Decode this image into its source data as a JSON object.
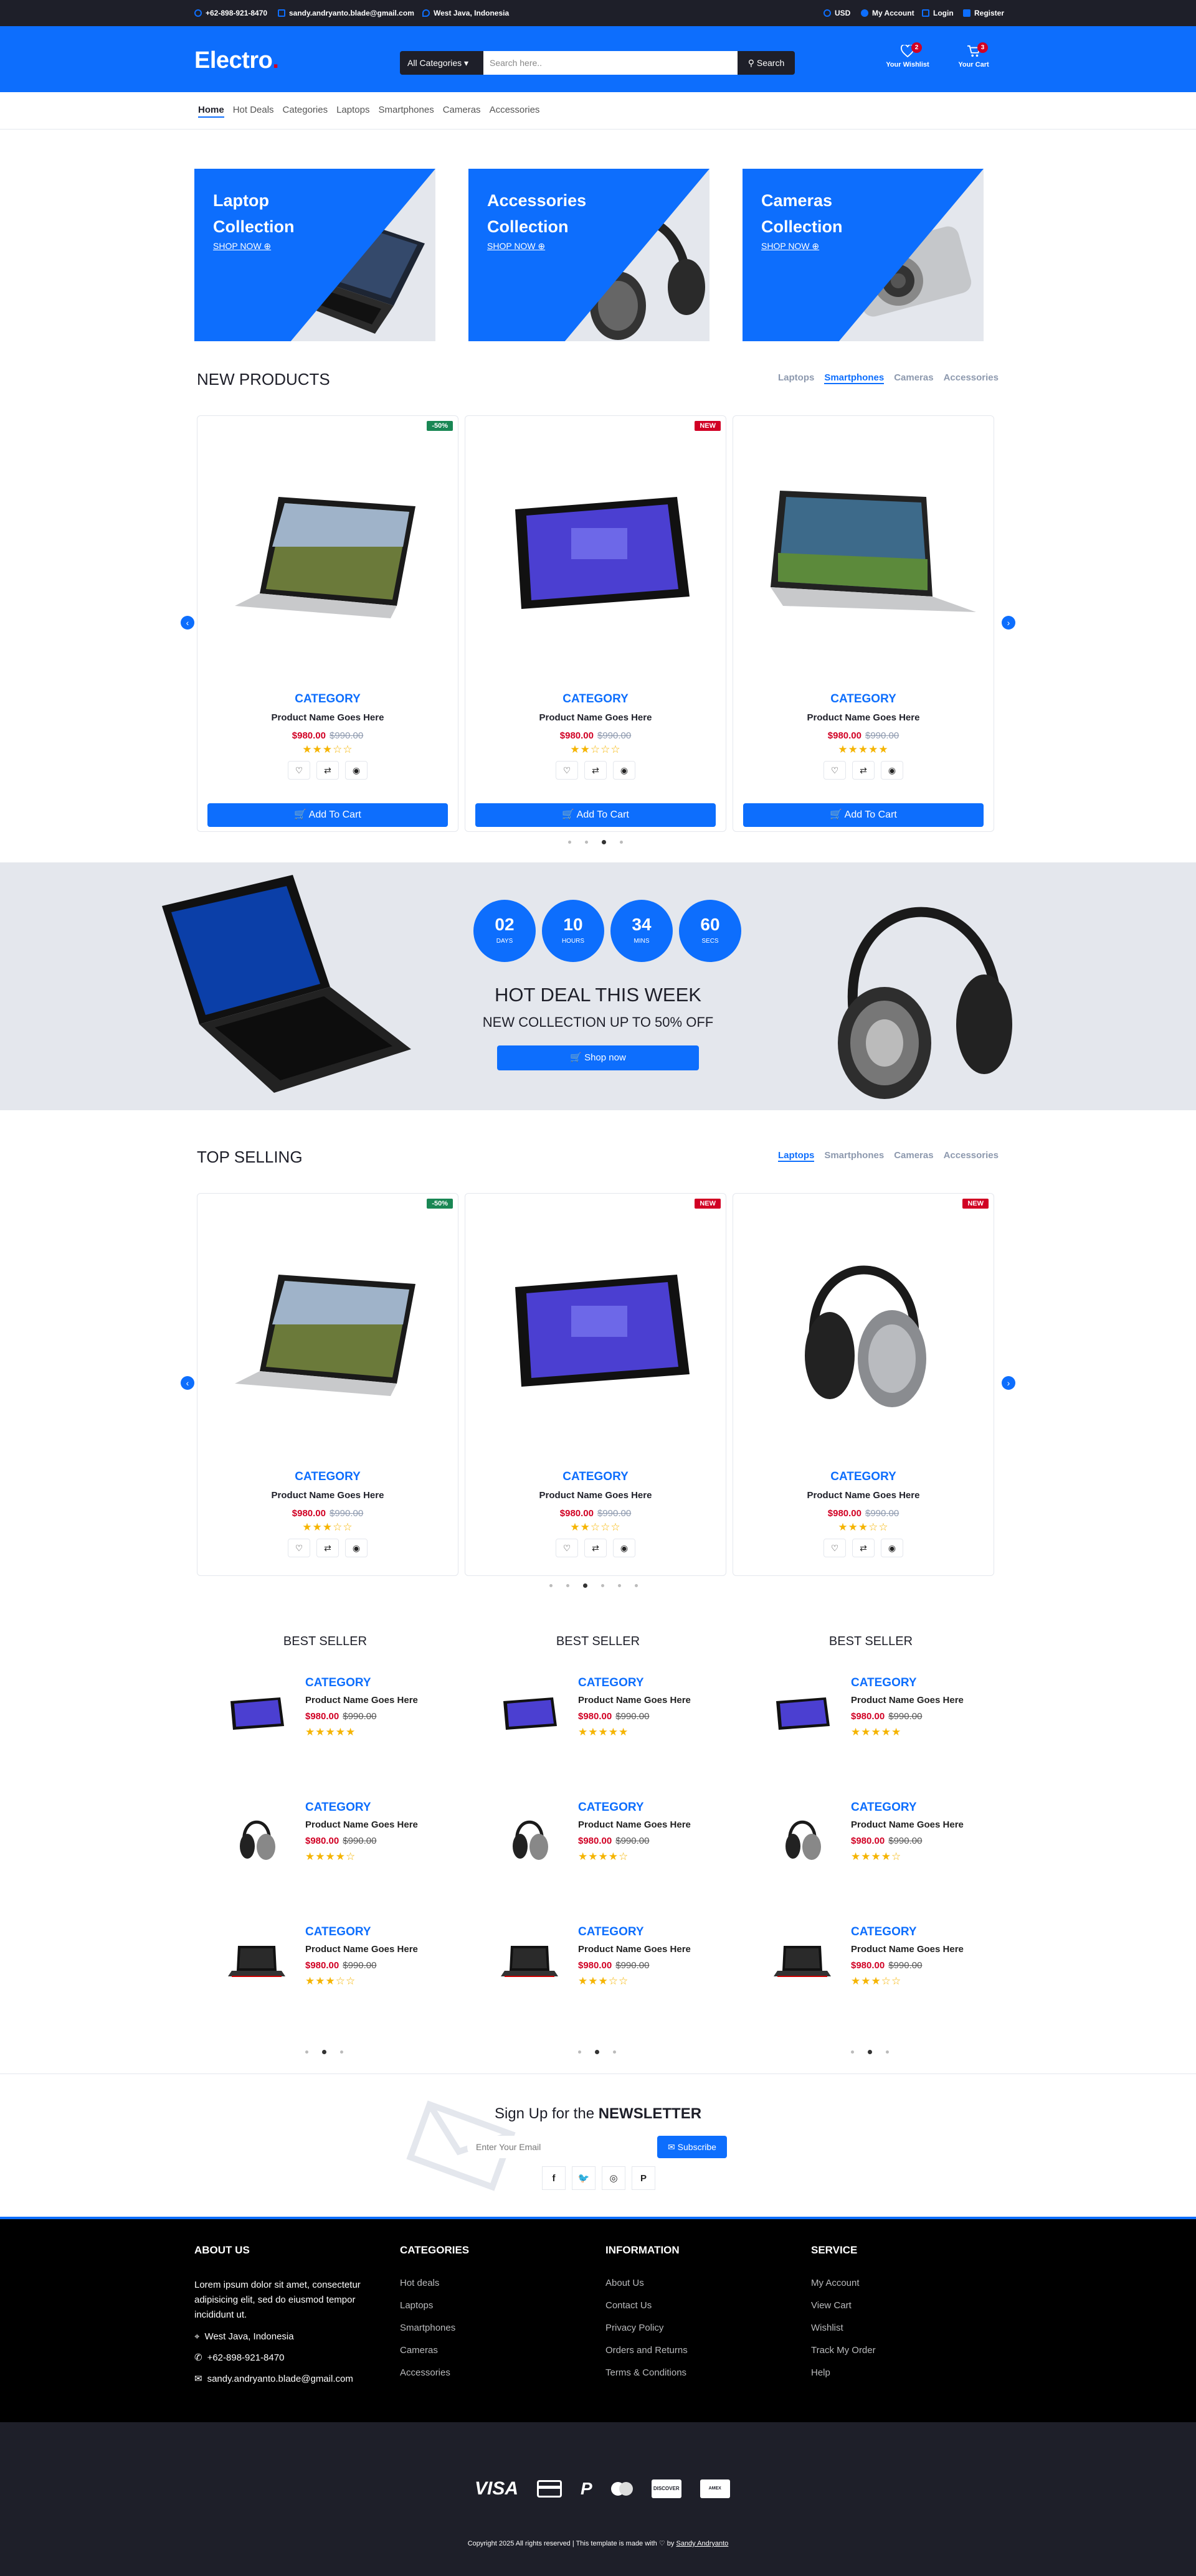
{
  "topbar": {
    "phone": "+62-898-921-8470",
    "email": "sandy.andryanto.blade@gmail.com",
    "location": "West Java, Indonesia",
    "currency": "USD",
    "account": "My Account",
    "login": "Login",
    "register": "Register"
  },
  "header": {
    "logo": "Electro",
    "logo_dot": ".",
    "category_select": "All Categories",
    "search_placeholder": "Search here..",
    "search_button": "Search",
    "wishlist_label": "Your Wishlist",
    "wishlist_count": "2",
    "cart_label": "Your Cart",
    "cart_count": "3"
  },
  "nav": [
    "Home",
    "Hot Deals",
    "Categories",
    "Laptops",
    "Smartphones",
    "Cameras",
    "Accessories"
  ],
  "collections": [
    {
      "title": "Laptop Collection",
      "cta": "SHOP NOW"
    },
    {
      "title": "Accessories Collection",
      "cta": "SHOP NOW"
    },
    {
      "title": "Cameras Collection",
      "cta": "SHOP NOW"
    }
  ],
  "new_products": {
    "title": "NEW PRODUCTS",
    "tabs": [
      "Laptops",
      "Smartphones",
      "Cameras",
      "Accessories"
    ],
    "active_tab": "Smartphones",
    "items": [
      {
        "label": "-50%",
        "category": "CATEGORY",
        "name": "Product Name Goes Here",
        "price": "$980.00",
        "old_price": "$990.00",
        "rating": 3,
        "add_to_cart": "Add To Cart"
      },
      {
        "label": "NEW",
        "category": "CATEGORY",
        "name": "Product Name Goes Here",
        "price": "$980.00",
        "old_price": "$990.00",
        "rating": 2,
        "add_to_cart": "Add To Cart"
      },
      {
        "label": "",
        "category": "CATEGORY",
        "name": "Product Name Goes Here",
        "price": "$980.00",
        "old_price": "$990.00",
        "rating": 5,
        "add_to_cart": "Add To Cart"
      }
    ]
  },
  "hot_deal": {
    "countdown": [
      {
        "value": "02",
        "unit": "DAYS"
      },
      {
        "value": "10",
        "unit": "HOURS"
      },
      {
        "value": "34",
        "unit": "MINS"
      },
      {
        "value": "60",
        "unit": "SECS"
      }
    ],
    "title": "HOT DEAL THIS WEEK",
    "subtitle": "NEW COLLECTION UP TO 50% OFF",
    "cta": "Shop now"
  },
  "top_selling": {
    "title": "TOP SELLING",
    "tabs": [
      "Laptops",
      "Smartphones",
      "Cameras",
      "Accessories"
    ],
    "active_tab": "Laptops",
    "items": [
      {
        "label": "-50%",
        "category": "CATEGORY",
        "name": "Product Name Goes Here",
        "price": "$980.00",
        "old_price": "$990.00",
        "rating": 3
      },
      {
        "label": "NEW",
        "category": "CATEGORY",
        "name": "Product Name Goes Here",
        "price": "$980.00",
        "old_price": "$990.00",
        "rating": 2
      },
      {
        "label": "NEW",
        "category": "CATEGORY",
        "name": "Product Name Goes Here",
        "price": "$980.00",
        "old_price": "$990.00",
        "rating": 3
      }
    ]
  },
  "best_seller": {
    "title": "BEST SELLER",
    "rows": [
      {
        "thumb": "tablet",
        "category": "CATEGORY",
        "name": "Product Name Goes Here",
        "price": "$980.00",
        "old_price": "$990.00",
        "rating": 5
      },
      {
        "thumb": "headphones",
        "category": "CATEGORY",
        "name": "Product Name Goes Here",
        "price": "$980.00",
        "old_price": "$990.00",
        "rating": 4
      },
      {
        "thumb": "laptop",
        "category": "CATEGORY",
        "name": "Product Name Goes Here",
        "price": "$980.00",
        "old_price": "$990.00",
        "rating": 3
      }
    ]
  },
  "newsletter": {
    "title_prefix": "Sign Up for the",
    "title_bold": "NEWSLETTER",
    "placeholder": "Enter Your Email",
    "button": "Subscribe",
    "socials": [
      "facebook-icon",
      "twitter-icon",
      "instagram-icon",
      "pinterest-icon"
    ]
  },
  "footer": {
    "about": {
      "title": "ABOUT US",
      "text": "Lorem ipsum dolor sit amet, consectetur adipisicing elit, sed do eiusmod tempor incididunt ut.",
      "location": "West Java, Indonesia",
      "phone": "+62-898-921-8470",
      "email": "sandy.andryanto.blade@gmail.com"
    },
    "categories": {
      "title": "CATEGORIES",
      "links": [
        "Hot deals",
        "Laptops",
        "Smartphones",
        "Cameras",
        "Accessories"
      ]
    },
    "information": {
      "title": "INFORMATION",
      "links": [
        "About Us",
        "Contact Us",
        "Privacy Policy",
        "Orders and Returns",
        "Terms & Conditions"
      ]
    },
    "service": {
      "title": "SERVICE",
      "links": [
        "My Account",
        "View Cart",
        "Wishlist",
        "Track My Order",
        "Help"
      ]
    },
    "payments": [
      "VISA",
      "credit-card-icon",
      "paypal-icon",
      "mastercard-icon",
      "discover-icon",
      "amex-icon"
    ],
    "copyright": "Copyright 2025 All rights reserved | This template is made with",
    "by": "by",
    "author": "Sandy Andryanto"
  },
  "colors": {
    "primary": "#0d6efd",
    "dark": "#1e1f29",
    "sale": "#d10024",
    "discount_badge": "#198754"
  }
}
